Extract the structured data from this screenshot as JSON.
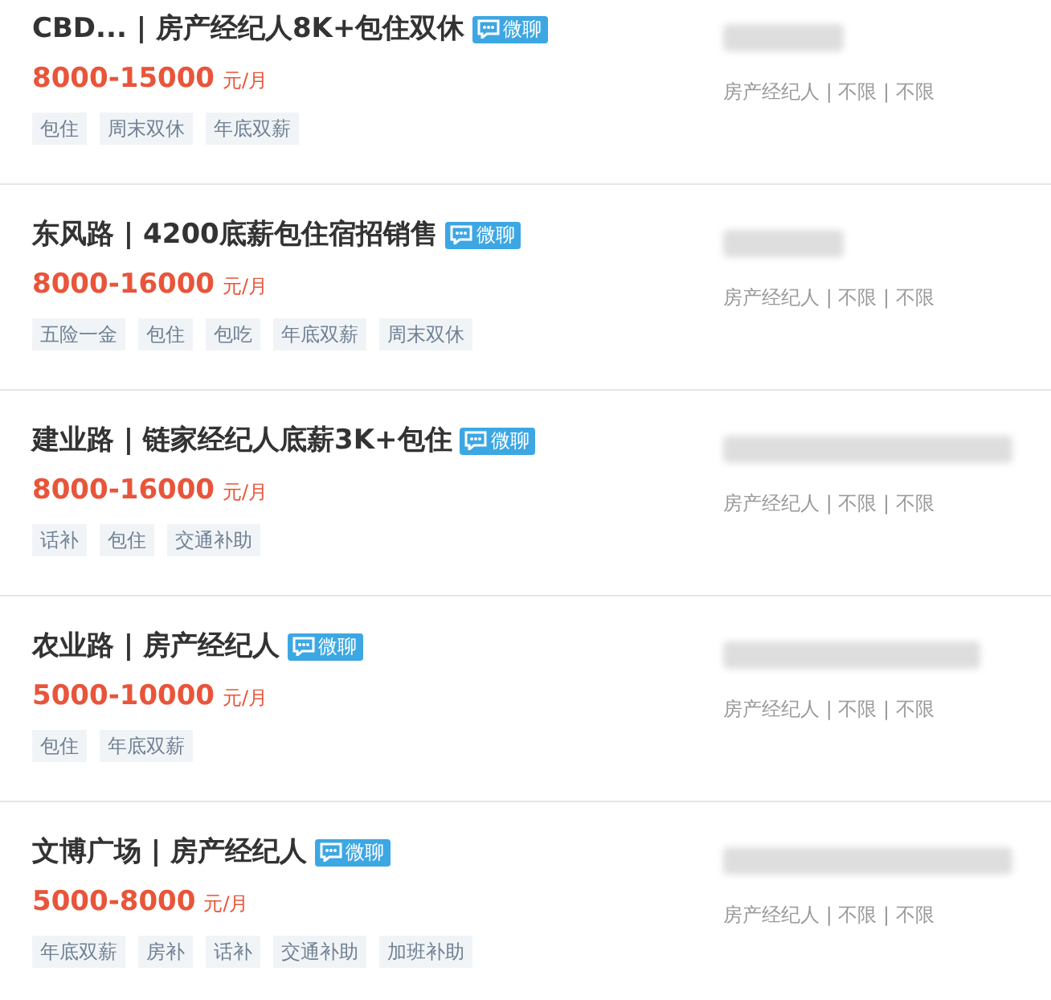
{
  "jobs": [
    {
      "title": "CBD... | 房产经纪人8K+包住双休",
      "chat_badge": "微聊",
      "salary": "8000-15000",
      "unit": "元/月",
      "tags": [
        "包住",
        "周末双休",
        "年底双薪"
      ],
      "meta": "房产经纪人 | 不限 | 不限"
    },
    {
      "title": "东风路 | 4200底薪包住宿招销售",
      "chat_badge": "微聊",
      "salary": "8000-16000",
      "unit": "元/月",
      "tags": [
        "五险一金",
        "包住",
        "包吃",
        "年底双薪",
        "周末双休"
      ],
      "meta": "房产经纪人 | 不限 | 不限"
    },
    {
      "title": "建业路 | 链家经纪人底薪3K+包住",
      "chat_badge": "微聊",
      "salary": "8000-16000",
      "unit": "元/月",
      "tags": [
        "话补",
        "包住",
        "交通补助"
      ],
      "meta": "房产经纪人 | 不限 | 不限"
    },
    {
      "title": "农业路 | 房产经纪人",
      "chat_badge": "微聊",
      "salary": "5000-10000",
      "unit": "元/月",
      "tags": [
        "包住",
        "年底双薪"
      ],
      "meta": "房产经纪人 | 不限 | 不限"
    },
    {
      "title": "文博广场 | 房产经纪人",
      "chat_badge": "微聊",
      "salary": "5000-8000",
      "unit": "元/月",
      "tags": [
        "年底双薪",
        "房补",
        "话补",
        "交通补助",
        "加班补助"
      ],
      "meta": "房产经纪人 | 不限 | 不限"
    }
  ]
}
